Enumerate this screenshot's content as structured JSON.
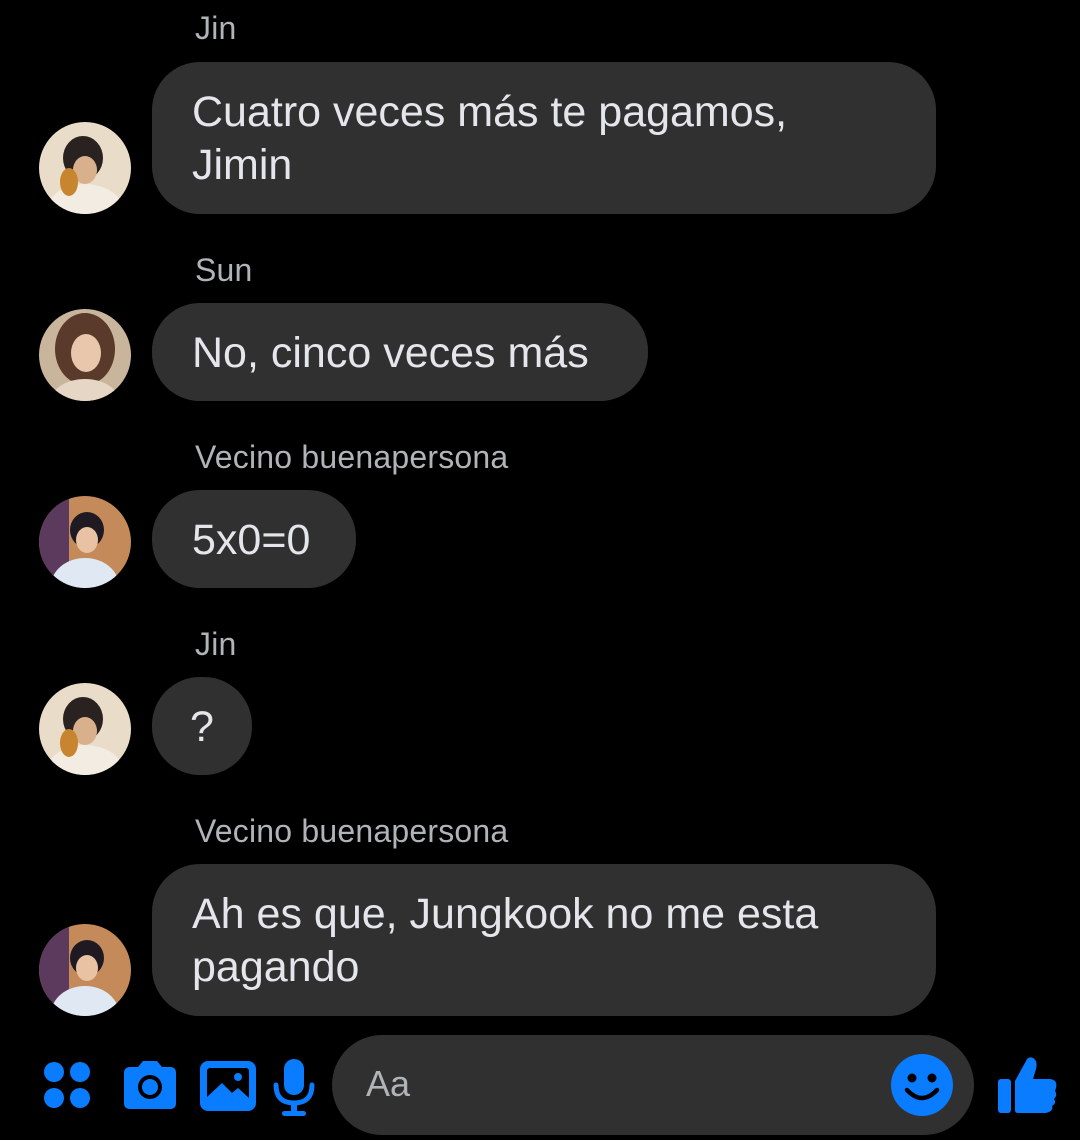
{
  "theme": {
    "accent": "#0a7cff",
    "bubble_bg": "#303030",
    "background": "#000000"
  },
  "messages": [
    {
      "sender": "Jin",
      "avatar": "avatar-jin",
      "text": "Cuatro veces más te pagamos,\nJimin"
    },
    {
      "sender": "Sun",
      "avatar": "avatar-sun",
      "text": "No, cinco veces más"
    },
    {
      "sender": "Vecino buenapersona",
      "avatar": "avatar-vecino",
      "text": "5x0=0"
    },
    {
      "sender": "Jin",
      "avatar": "avatar-jin",
      "text": "?"
    },
    {
      "sender": "Vecino buenapersona",
      "avatar": "avatar-vecino",
      "text": "Ah es que, Jungkook no me esta\npagando"
    }
  ],
  "composer": {
    "placeholder": "Aa",
    "icons": [
      "apps-grid-icon",
      "camera-icon",
      "gallery-icon",
      "microphone-icon",
      "emoji-icon",
      "thumbs-up-icon"
    ]
  }
}
